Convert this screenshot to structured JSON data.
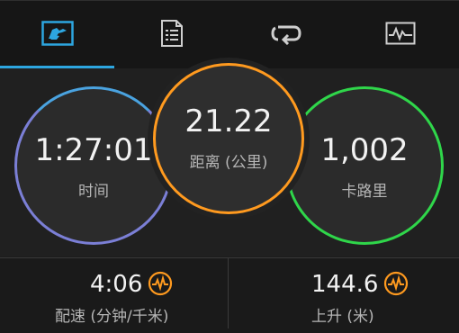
{
  "tabs": [
    {
      "name": "data-fields",
      "icon": "run-stats-icon",
      "active": true
    },
    {
      "name": "details",
      "icon": "document-list-icon",
      "active": false
    },
    {
      "name": "laps",
      "icon": "loop-icon",
      "active": false
    },
    {
      "name": "charts",
      "icon": "chart-icon",
      "active": false
    }
  ],
  "stats": {
    "time": {
      "value": "1:27:01",
      "label": "时间",
      "color": "#7b7fd6"
    },
    "distance": {
      "value": "21.22",
      "label": "距离 (公里)",
      "color": "#ff9a1f"
    },
    "calories": {
      "value": "1,002",
      "label": "卡路里",
      "color": "#2fd64a"
    }
  },
  "metrics": {
    "pace": {
      "value": "4:06",
      "label": "配速 (分钟/千米)",
      "icon": "activity-icon"
    },
    "ascent": {
      "value": "144.6",
      "label": "上升 (米)",
      "icon": "activity-icon"
    }
  },
  "colors": {
    "accent": "#2da6e0",
    "orange": "#ff9a1f"
  }
}
